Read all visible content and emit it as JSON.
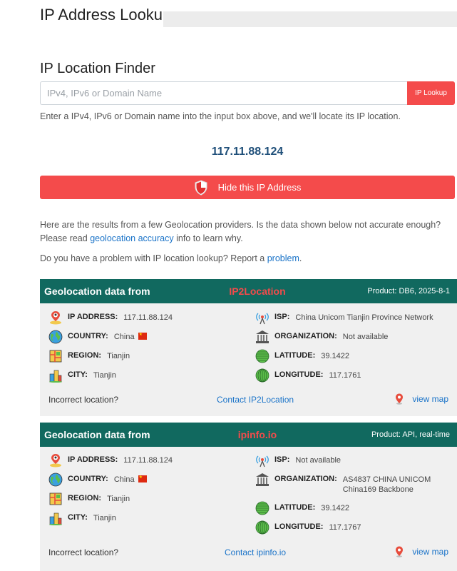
{
  "header": {
    "title": "IP Address Lookup"
  },
  "finder": {
    "title": "IP Location Finder",
    "placeholder": "IPv4, IPv6 or Domain Name",
    "button_label": "IP Lookup",
    "help": "Enter a IPv4, IPv6 or Domain name into the input box above, and we'll locate its IP location."
  },
  "current_ip": "117.11.88.124",
  "hide_button": {
    "label": "Hide this IP Address"
  },
  "intro": {
    "line1": "Here are the results from a few Geolocation providers. Is the data shown below not accurate enough?",
    "please_read": "Please read ",
    "accuracy_link": "geolocation accuracy",
    "accuracy_suffix": " info to learn why.",
    "problem_text": "Do you have a problem with IP location lookup? Report a ",
    "problem_link": "problem",
    "problem_suffix": "."
  },
  "labels": {
    "geo_from": "Geolocation data from",
    "ip_address": "IP ADDRESS:",
    "country": "COUNTRY:",
    "region": "REGION:",
    "city": "CITY:",
    "isp": "ISP:",
    "organization": "ORGANIZATION:",
    "latitude": "LATITUDE:",
    "longitude": "LONGITUDE:",
    "incorrect": "Incorrect location?",
    "view_map": "view map"
  },
  "providers": [
    {
      "name": "IP2Location",
      "product": "Product: DB6, 2025-8-1",
      "ip": "117.11.88.124",
      "country": "China",
      "region": "Tianjin",
      "city": "Tianjin",
      "isp": "China Unicom Tianjin Province Network",
      "organization": "Not available",
      "latitude": "39.1422",
      "longitude": "117.1761",
      "contact": "Contact IP2Location"
    },
    {
      "name": "ipinfo.io",
      "product": "Product: API, real-time",
      "ip": "117.11.88.124",
      "country": "China",
      "region": "Tianjin",
      "city": "Tianjin",
      "isp": "Not available",
      "organization_line1": "AS4837 CHINA UNICOM",
      "organization_line2": "China169 Backbone",
      "latitude": "39.1422",
      "longitude": "117.1767",
      "contact": "Contact ipinfo.io"
    }
  ],
  "colors": {
    "accent_red": "#f44b4b",
    "header_teal": "#11695f",
    "link_blue": "#1a73c8",
    "ip_blue": "#20507a"
  },
  "icons": [
    "person-pin-icon",
    "globe-icon",
    "region-map-icon",
    "city-icon",
    "antenna-icon",
    "organization-icon",
    "latitude-globe-icon",
    "longitude-globe-icon",
    "map-pin-icon",
    "shield-icon"
  ]
}
